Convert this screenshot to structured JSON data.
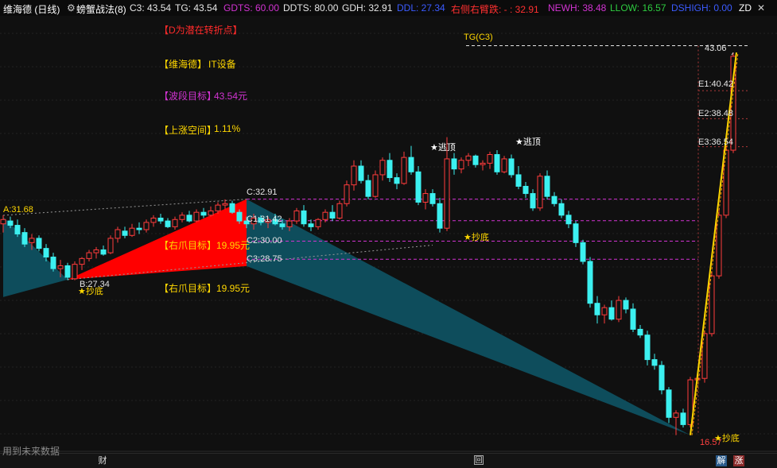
{
  "header": {
    "stock_name": "维海德 (日线)",
    "indicator_name": "螃蟹战法(8)",
    "items": [
      {
        "key": "c3",
        "text": "C3: 43.54",
        "color": "#e6e6e6"
      },
      {
        "key": "tg",
        "text": "TG: 43.54",
        "color": "#e6e6e6"
      },
      {
        "key": "gdts",
        "text": "GDTS: 60.00",
        "color": "#d233d2"
      },
      {
        "key": "ddts",
        "text": "DDTS: 80.00",
        "color": "#e6e6e6"
      },
      {
        "key": "gdh",
        "text": "GDH: 32.91",
        "color": "#e6e6e6"
      },
      {
        "key": "ddl",
        "text": "DDL: 27.34",
        "color": "#3b5bff"
      },
      {
        "key": "right_arm",
        "text": "右侧右臂跌: - : 32.91",
        "color": "#ff3030"
      },
      {
        "key": "newh",
        "text": "NEWH: 38.48",
        "color": "#d233d2"
      },
      {
        "key": "llow",
        "text": "LLOW: 16.57",
        "color": "#2ecc40"
      },
      {
        "key": "dshigh",
        "text": "DSHIGH: 0.00",
        "color": "#3b5bff"
      }
    ],
    "zd": "ZD"
  },
  "notes": {
    "turn_point": "【D为潜在转折点】",
    "stock": "【维海德】",
    "industry": "IT设备",
    "wave_target_label": "【波段目标】",
    "wave_target_value": "43.54元",
    "upside_label": "【上涨空间】",
    "upside_value": "1.11%"
  },
  "annotations": {
    "A": "A:31.68",
    "B": "B:27.34",
    "C": "C:32.91",
    "C1": "C1:31.42",
    "C2": "C2:30.00",
    "C3": "C3:28.75",
    "claw1": "【右爪目标】19.95元",
    "claw2": "【右爪目标】19.95元",
    "tgc3": "TG(C3)",
    "e1": "E1:40.42",
    "e2": "E2:38.48",
    "e3": "E3:36.54",
    "high": "43.06",
    "low": "16.57",
    "bottom1": "★抄底",
    "bottom2": "★抄底",
    "bottom3": "★抄底",
    "top1": "★逃顶",
    "top2": "★逃顶"
  },
  "bottom": {
    "future_data": "用到未来数据",
    "cai": "财",
    "hui": "回",
    "jie": "解",
    "zhang": "涨"
  },
  "colors": {
    "up": "#ff3c3c",
    "down": "#3cf0f0",
    "crab": "#ff0000",
    "teal": "#0e4d5c",
    "magenta_line": "#d233d2",
    "yellow": "#ffd700"
  },
  "chart_data": {
    "type": "candlestick",
    "y_range": [
      16.0,
      44.5
    ],
    "levels": {
      "A": 31.68,
      "B": 27.34,
      "C": 32.91,
      "C1": 31.42,
      "C2": 30.0,
      "C3": 28.75,
      "TG_C3": 43.54,
      "E1": 40.42,
      "E2": 38.48,
      "E3": 36.54,
      "high": 43.06,
      "low": 16.57
    },
    "candles": [
      [
        31.2,
        31.8,
        30.6,
        31.5
      ],
      [
        31.4,
        31.7,
        30.9,
        31.1
      ],
      [
        31.1,
        31.5,
        30.3,
        30.5
      ],
      [
        30.6,
        30.9,
        29.6,
        29.8
      ],
      [
        29.9,
        30.5,
        29.4,
        30.2
      ],
      [
        30.2,
        30.4,
        29.3,
        29.5
      ],
      [
        29.5,
        29.8,
        28.6,
        28.9
      ],
      [
        28.9,
        29.2,
        27.9,
        28.1
      ],
      [
        28.1,
        28.7,
        27.5,
        28.3
      ],
      [
        28.3,
        28.5,
        27.3,
        27.5
      ],
      [
        27.4,
        28.6,
        27.3,
        28.4
      ],
      [
        28.4,
        28.9,
        28.0,
        28.8
      ],
      [
        28.8,
        29.4,
        28.6,
        29.2
      ],
      [
        29.2,
        29.6,
        28.8,
        29.4
      ],
      [
        29.4,
        29.7,
        29.0,
        29.1
      ],
      [
        29.2,
        30.4,
        29.1,
        30.2
      ],
      [
        30.2,
        31.0,
        29.9,
        30.8
      ],
      [
        30.7,
        31.0,
        30.2,
        30.4
      ],
      [
        30.4,
        31.2,
        30.3,
        30.9
      ],
      [
        30.9,
        31.3,
        30.5,
        30.8
      ],
      [
        30.8,
        31.5,
        30.6,
        31.3
      ],
      [
        31.3,
        31.8,
        31.0,
        31.6
      ],
      [
        31.6,
        31.9,
        31.2,
        31.4
      ],
      [
        31.4,
        31.6,
        30.9,
        31.0
      ],
      [
        31.0,
        31.7,
        30.8,
        31.5
      ],
      [
        31.5,
        32.0,
        31.3,
        31.8
      ],
      [
        31.8,
        32.1,
        31.3,
        31.4
      ],
      [
        31.4,
        32.2,
        31.3,
        32.0
      ],
      [
        32.0,
        32.3,
        31.6,
        31.8
      ],
      [
        31.8,
        32.4,
        31.7,
        32.1
      ],
      [
        32.1,
        32.7,
        31.9,
        32.5
      ],
      [
        32.5,
        32.9,
        32.2,
        32.6
      ],
      [
        32.6,
        32.8,
        31.9,
        32.0
      ],
      [
        32.0,
        32.2,
        31.2,
        31.4
      ],
      [
        31.4,
        31.7,
        30.9,
        31.2
      ],
      [
        31.2,
        31.9,
        30.8,
        31.6
      ],
      [
        31.6,
        31.8,
        31.1,
        31.3
      ],
      [
        31.3,
        31.7,
        30.9,
        31.5
      ],
      [
        31.5,
        31.9,
        31.1,
        31.2
      ],
      [
        31.2,
        31.5,
        30.8,
        31.0
      ],
      [
        31.0,
        31.6,
        30.7,
        31.4
      ],
      [
        31.4,
        32.3,
        31.2,
        32.1
      ],
      [
        32.1,
        32.5,
        31.0,
        31.2
      ],
      [
        31.2,
        31.5,
        30.7,
        31.0
      ],
      [
        31.0,
        31.6,
        30.8,
        31.5
      ],
      [
        31.5,
        32.2,
        31.3,
        32.0
      ],
      [
        32.0,
        32.5,
        31.4,
        31.6
      ],
      [
        31.6,
        32.8,
        31.5,
        32.6
      ],
      [
        32.6,
        34.2,
        32.4,
        33.9
      ],
      [
        33.9,
        35.6,
        33.5,
        35.2
      ],
      [
        35.2,
        35.6,
        34.0,
        34.2
      ],
      [
        34.2,
        34.6,
        32.9,
        33.1
      ],
      [
        33.1,
        34.9,
        33.0,
        34.6
      ],
      [
        34.6,
        35.8,
        34.2,
        35.6
      ],
      [
        35.6,
        36.1,
        34.1,
        34.4
      ],
      [
        34.4,
        34.7,
        33.6,
        34.0
      ],
      [
        34.0,
        36.2,
        33.9,
        35.8
      ],
      [
        35.8,
        36.6,
        34.6,
        34.8
      ],
      [
        34.8,
        35.2,
        32.5,
        32.7
      ],
      [
        32.7,
        33.6,
        32.2,
        33.3
      ],
      [
        33.3,
        33.6,
        32.4,
        32.6
      ],
      [
        32.6,
        33.0,
        30.6,
        30.9
      ],
      [
        30.9,
        37.2,
        30.7,
        35.7
      ],
      [
        35.7,
        36.1,
        34.6,
        35.0
      ],
      [
        35.0,
        35.8,
        34.7,
        35.6
      ],
      [
        35.6,
        36.1,
        35.2,
        35.9
      ],
      [
        35.9,
        36.0,
        35.1,
        35.3
      ],
      [
        35.3,
        35.6,
        34.9,
        35.4
      ],
      [
        35.4,
        36.2,
        35.0,
        36.0
      ],
      [
        36.0,
        36.3,
        34.6,
        34.8
      ],
      [
        34.8,
        35.9,
        34.7,
        35.7
      ],
      [
        35.7,
        36.0,
        34.4,
        34.6
      ],
      [
        34.6,
        35.2,
        33.6,
        33.8
      ],
      [
        33.8,
        34.1,
        33.0,
        33.3
      ],
      [
        33.3,
        33.6,
        32.1,
        32.3
      ],
      [
        32.3,
        34.7,
        32.1,
        34.5
      ],
      [
        34.5,
        34.9,
        32.9,
        33.1
      ],
      [
        33.1,
        33.4,
        32.4,
        32.6
      ],
      [
        32.6,
        32.9,
        31.6,
        31.8
      ],
      [
        31.8,
        32.1,
        30.9,
        31.2
      ],
      [
        31.2,
        31.4,
        29.6,
        29.9
      ],
      [
        29.9,
        30.1,
        28.4,
        28.6
      ],
      [
        28.6,
        28.9,
        25.4,
        25.7
      ],
      [
        25.7,
        26.2,
        24.3,
        24.9
      ],
      [
        24.9,
        25.6,
        24.3,
        25.4
      ],
      [
        25.4,
        25.9,
        24.5,
        24.6
      ],
      [
        24.6,
        26.2,
        24.4,
        25.9
      ],
      [
        25.9,
        26.1,
        25.0,
        25.3
      ],
      [
        25.3,
        25.7,
        23.7,
        23.9
      ],
      [
        23.9,
        24.2,
        23.3,
        23.5
      ],
      [
        23.5,
        23.8,
        21.4,
        21.8
      ],
      [
        21.8,
        22.2,
        21.1,
        21.4
      ],
      [
        21.4,
        21.7,
        19.4,
        19.7
      ],
      [
        19.7,
        19.9,
        17.4,
        17.8
      ],
      [
        17.8,
        18.3,
        16.57,
        18.1
      ],
      [
        18.1,
        18.4,
        17.1,
        17.3
      ],
      [
        17.3,
        20.6,
        17.1,
        20.4
      ],
      [
        20.4,
        20.6,
        20.3,
        20.5
      ],
      [
        20.5,
        23.8,
        20.2,
        23.6
      ],
      [
        23.6,
        27.9,
        23.4,
        27.6
      ],
      [
        27.6,
        32.2,
        27.4,
        31.8
      ],
      [
        31.8,
        36.6,
        31.6,
        36.3
      ],
      [
        36.3,
        43.06,
        36.1,
        42.8
      ]
    ]
  }
}
